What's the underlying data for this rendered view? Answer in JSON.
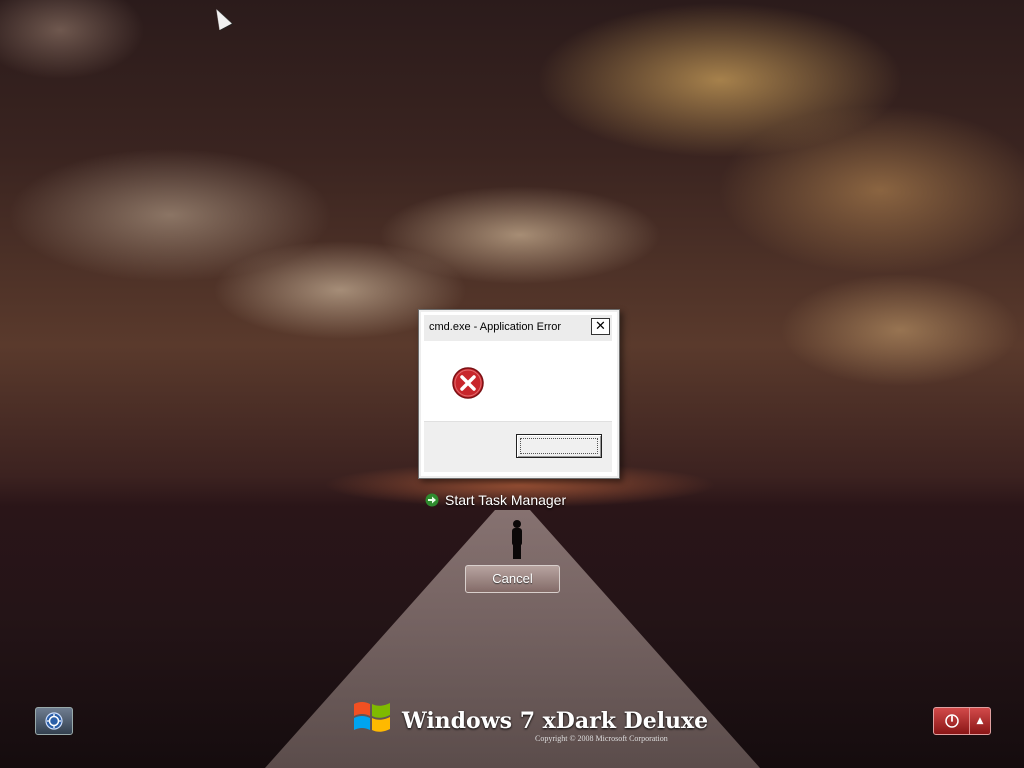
{
  "dialog": {
    "title": "cmd.exe - Application Error",
    "close_label": "✕",
    "icon": "error-icon",
    "ok_label": ""
  },
  "options": {
    "task_manager_label": "Start Task Manager",
    "task_manager_icon": "green-arrow-icon"
  },
  "cancel_label": "Cancel",
  "footer": {
    "brand_name": "Windows 7 xDark Deluxe",
    "copyright": "Copyright © 2008 Microsoft Corporation",
    "ease_of_access_icon": "ease-of-access-icon",
    "power_icon": "power-icon",
    "power_options_icon": "chevron-up-icon"
  },
  "colors": {
    "error_red": "#c8262c",
    "power_red": "#b22a2a",
    "task_arrow": "#4bbf4b"
  }
}
